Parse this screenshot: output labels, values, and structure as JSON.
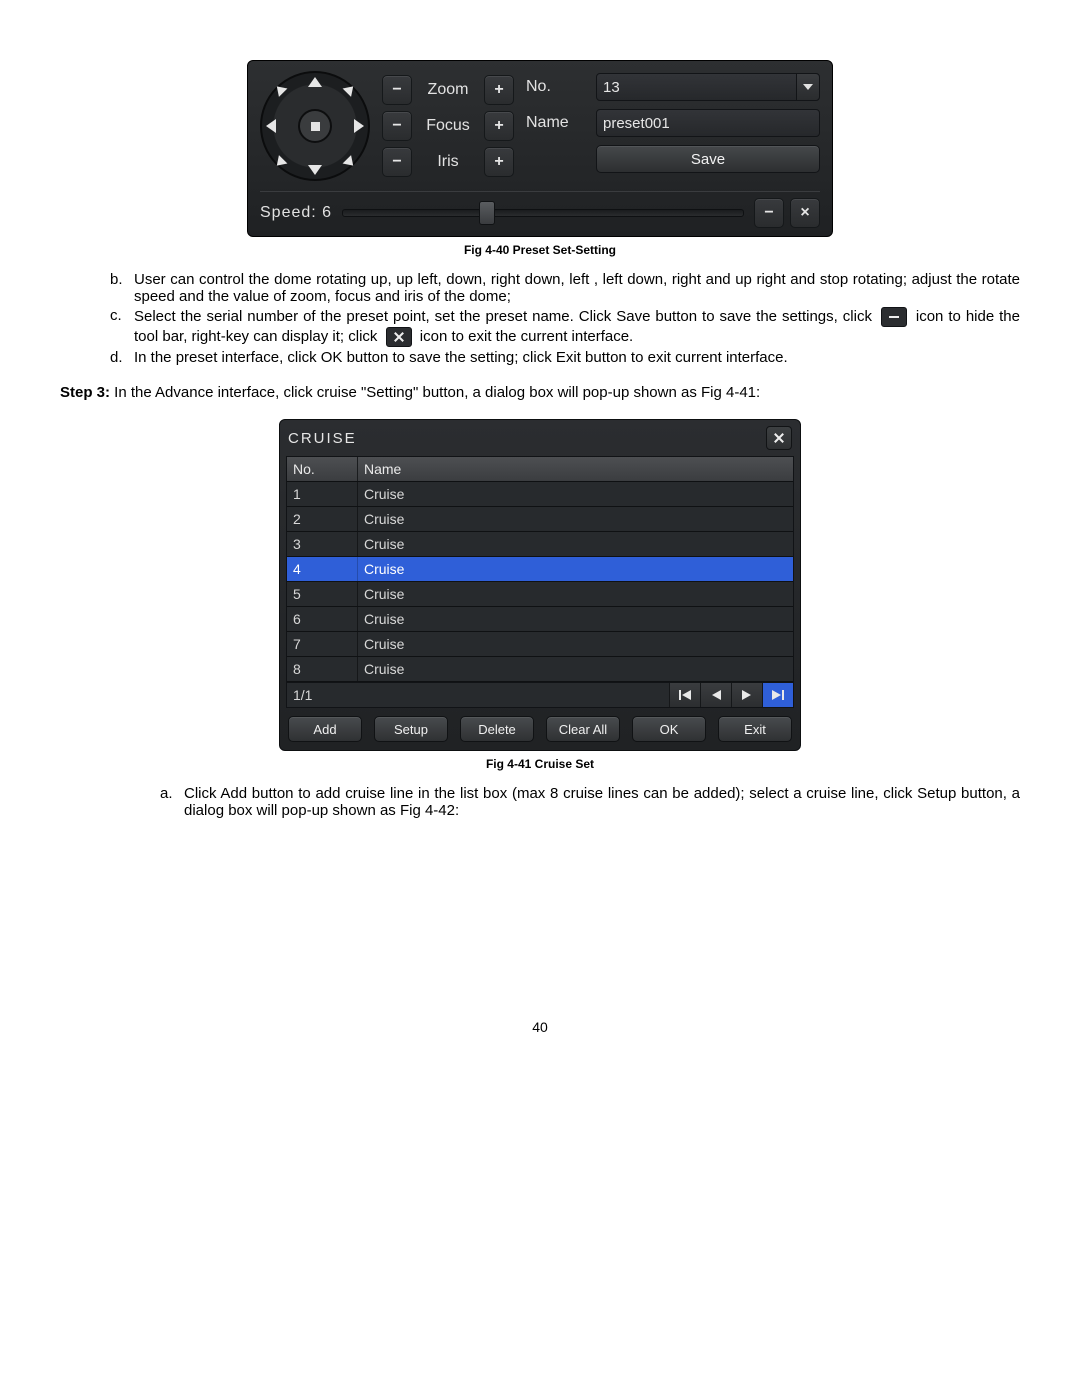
{
  "preset_panel": {
    "zoom_label": "Zoom",
    "focus_label": "Focus",
    "iris_label": "Iris",
    "no_label": "No.",
    "name_label": "Name",
    "no_value": "13",
    "name_value": "preset001",
    "save_label": "Save",
    "speed_label": "Speed:",
    "speed_value": "6",
    "minus": "−",
    "plus": "+"
  },
  "captions": {
    "fig40": "Fig 4-40 Preset Set-Setting",
    "fig41": "Fig 4-41 Cruise Set"
  },
  "instructions": {
    "b_marker": "b.",
    "b_text": "User can control the dome rotating up, up left, down, right down, left , left down, right and up right and stop rotating; adjust the rotate speed and the value of zoom, focus and iris of the dome;",
    "c_marker": "c.",
    "c_text_1": "Select the serial number of the preset point, set the preset name. Click Save button to save the settings, click ",
    "c_text_2": " icon to hide the tool bar, right-key can display it; click ",
    "c_text_3": " icon to exit the current interface.",
    "d_marker": "d.",
    "d_text": "In the preset interface, click OK button to save the setting; click Exit button to exit current interface.",
    "step3_label": "Step 3:",
    "step3_text": " In the Advance interface, click cruise \"Setting\" button, a dialog box will pop-up shown as Fig 4-41:",
    "a_marker": "a.",
    "a_text": "Click Add button to add cruise line in the list box (max 8 cruise lines can be added); select a cruise line, click Setup button, a dialog box will pop-up shown as Fig 4-42:"
  },
  "cruise": {
    "title": "CRUISE",
    "col_no": "No.",
    "col_name": "Name",
    "rows": [
      {
        "no": "1",
        "name": "Cruise",
        "selected": false
      },
      {
        "no": "2",
        "name": "Cruise",
        "selected": false
      },
      {
        "no": "3",
        "name": "Cruise",
        "selected": false
      },
      {
        "no": "4",
        "name": "Cruise",
        "selected": true
      },
      {
        "no": "5",
        "name": "Cruise",
        "selected": false
      },
      {
        "no": "6",
        "name": "Cruise",
        "selected": false
      },
      {
        "no": "7",
        "name": "Cruise",
        "selected": false
      },
      {
        "no": "8",
        "name": "Cruise",
        "selected": false
      }
    ],
    "page": "1/1",
    "buttons": {
      "add": "Add",
      "setup": "Setup",
      "delete": "Delete",
      "clear_all": "Clear All",
      "ok": "OK",
      "exit": "Exit"
    }
  },
  "page_number": "40"
}
